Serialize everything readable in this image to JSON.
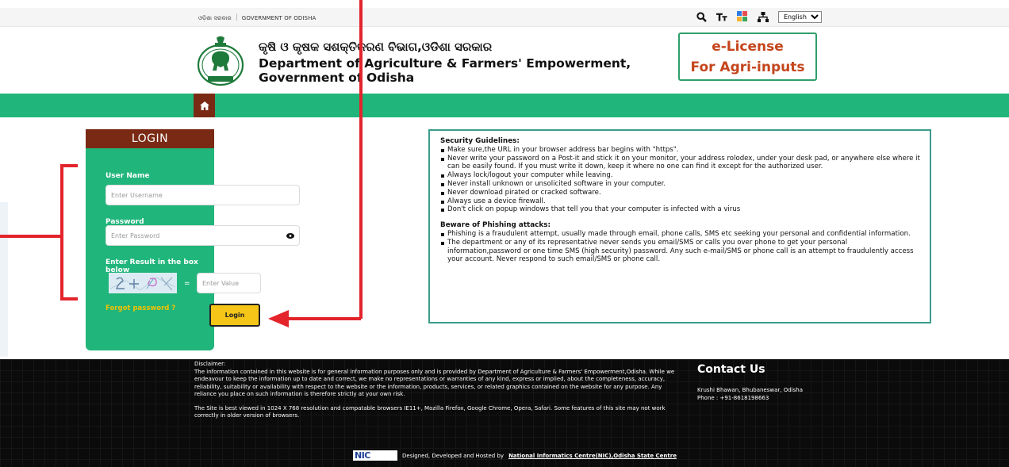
{
  "topbar": {
    "odia_gov": "ଓଡ଼ିଶା ସରକାର",
    "gov_text": "GOVERNMENT OF ODISHA",
    "tools": [
      "search-icon",
      "text-size-icon",
      "color-contrast-icon",
      "sitemap-icon"
    ],
    "language": "English"
  },
  "header": {
    "odia_title": "କୃଷି ଓ କୃଷକ ସଶକ୍ତିକରଣ ବିଭାଗ,ଓଡିଶା ସରକାର",
    "title_line1": "Department of Agriculture & Farmers' Empowerment,",
    "title_line2": "Government of Odisha",
    "elicense_line1": "e-License",
    "elicense_line2": "For Agri-inputs"
  },
  "nav": {
    "home_icon": "home-icon"
  },
  "login": {
    "heading": "LOGIN",
    "username_label": "User Name",
    "username_placeholder": "Enter Username",
    "password_label": "Password",
    "password_placeholder": "Enter Password",
    "captcha_label": "Enter Result in the box below",
    "captcha_eq": "=",
    "captcha_placeholder": "Enter Value",
    "forgot": "Forgot password ?",
    "button": "Login"
  },
  "guidelines": {
    "security_heading": "Security Guidelines:",
    "security_items": [
      "Make sure,the URL in your browser address bar begins with \"https\".",
      "Never write your password on a Post-it and stick it on your monitor, your address rolodex, under your desk pad, or anywhere else where it can be easily found. If you must write it down, keep it where no one can find it except for the authorized user.",
      "Always lock/logout your computer while leaving.",
      "Never install unknown or unsolicited software in your computer.",
      "Never download pirated or cracked software.",
      "Always use a device firewall.",
      "Don't click on popup windows that tell you that your computer is infected with a virus"
    ],
    "phishing_heading": "Beware of Phishing attacks:",
    "phishing_items": [
      "Phishing is a fraudulent attempt, usually made through email, phone calls, SMS etc seeking your personal and confidential information.",
      "The department or any of its representative never sends you email/SMS or calls you over phone to get your personal information,password or one time SMS (high security) password. Any such e-mail/SMS or phone call is an attempt to fraudulently access your account. Never respond to such email/SMS or phone call."
    ]
  },
  "footer": {
    "disclaimer_title": "Disclaimer:",
    "disclaimer_text": "The information contained in this website is for general information purposes only and is provided by Department of Agriculture & Farmers' Empowerment,Odisha. While we endeavour to keep the information up to date and correct, we make no representations or warranties of any kind, express or implied, about the completeness, accuracy, reliability, suitability or availability with respect to the website or the information, products, services, or related graphics contained on the website for any purpose. Any reliance you place on such information is therefore strictly at your own risk.",
    "browser_note": "The Site is best viewed in 1024 X 768 resolution and compatable browsers IE11+, Mozilla Firefox, Google Chrome, Opera, Safari. Some features of this site may not work correctly in older version of browsers.",
    "contact_heading": "Contact Us",
    "contact_address": "Krushi Bhawan, Bhubaneswar, Odisha",
    "contact_phone": "Phone : +91-8618198663",
    "credit_prefix": "Designed, Developed and Hosted by",
    "credit_link": "National Informatics Centre(NIC),Odisha State Centre",
    "nic_logo_text": "NIC"
  },
  "colors": {
    "green": "#20b57b",
    "maroon": "#7a2a14",
    "annotation_red": "#e3242b",
    "login_yellow": "#f5c518"
  }
}
